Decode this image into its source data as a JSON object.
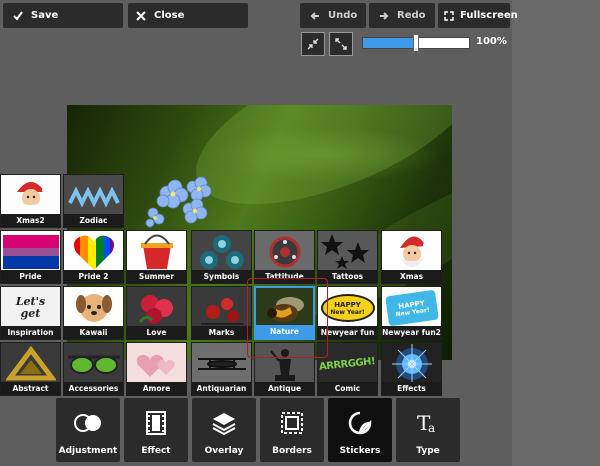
{
  "toolbar": {
    "save_label": "Save",
    "close_label": "Close",
    "undo_label": "Undo",
    "redo_label": "Redo",
    "fullscreen_label": "Fullscreen"
  },
  "zoom": {
    "value_label": "100%",
    "level": 0.5
  },
  "stickers": [
    {
      "label": "Xmas2",
      "icon": "santa"
    },
    {
      "label": "Zodiac",
      "icon": "zodiac"
    },
    {
      "label": "Pride",
      "icon": "pride-flag"
    },
    {
      "label": "Pride 2",
      "icon": "pride-heart"
    },
    {
      "label": "Summer",
      "icon": "bucket"
    },
    {
      "label": "Symbols",
      "icon": "symbols"
    },
    {
      "label": "Tattitude",
      "icon": "tattoo-reel"
    },
    {
      "label": "Tattoos",
      "icon": "stars"
    },
    {
      "label": "Xmas",
      "icon": "santa-2"
    },
    {
      "label": "Inspiration",
      "icon": "lets-get"
    },
    {
      "label": "Kawaii",
      "icon": "puppy"
    },
    {
      "label": "Love",
      "icon": "roses"
    },
    {
      "label": "Marks",
      "icon": "mark-flowers"
    },
    {
      "label": "Nature",
      "icon": "bee"
    },
    {
      "label": "Newyear fun",
      "icon": "happy-new-year"
    },
    {
      "label": "Newyear fun2",
      "icon": "happy-new-year-2"
    },
    {
      "label": "Abstract",
      "icon": "gold-triangle"
    },
    {
      "label": "Accessories",
      "icon": "sunglasses"
    },
    {
      "label": "Amore",
      "icon": "hearts"
    },
    {
      "label": "Antiquarian",
      "icon": "biplane"
    },
    {
      "label": "Antique",
      "icon": "statue"
    },
    {
      "label": "Comic",
      "icon": "arrrggh"
    },
    {
      "label": "Effects",
      "icon": "burst"
    }
  ],
  "sticker_texts": {
    "lets_get": "Let's get",
    "happy": "HAPPY",
    "new_year": "New Year!",
    "arrrggh": "ARRRGGH!"
  },
  "selected_sticker": "Nature",
  "tools": [
    {
      "label": "Adjustment",
      "icon": "circles-icon"
    },
    {
      "label": "Effect",
      "icon": "film-icon"
    },
    {
      "label": "Overlay",
      "icon": "layers-icon"
    },
    {
      "label": "Borders",
      "icon": "frame-icon"
    },
    {
      "label": "Stickers",
      "icon": "sticker-icon"
    },
    {
      "label": "Type",
      "icon": "type-icon"
    }
  ],
  "active_tool": "Stickers",
  "colors": {
    "accent": "#3d9be9",
    "toolbar_bg": "#2b2b2b",
    "canvas_bg": "#5e5e5e",
    "selection_outline": "#b02020"
  }
}
